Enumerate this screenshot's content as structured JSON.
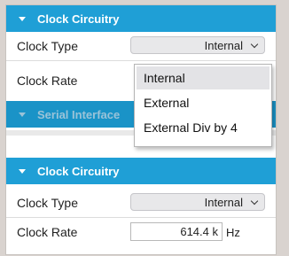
{
  "top_section": {
    "header": "Clock Circuitry",
    "clock_type_label": "Clock Type",
    "clock_type_value": "Internal",
    "clock_rate_label": "Clock Rate"
  },
  "serial_section": {
    "header": "Serial Interface"
  },
  "dropdown": {
    "options": [
      "Internal",
      "External",
      "External Div by 4"
    ],
    "selected": "Internal"
  },
  "bottom_section": {
    "header": "Clock Circuitry",
    "clock_type_label": "Clock Type",
    "clock_type_value": "Internal",
    "clock_rate_label": "Clock Rate",
    "clock_rate_value": "614.4 k",
    "clock_rate_unit": "Hz"
  },
  "colors": {
    "header_bg": "#1f9fd6",
    "header_text": "#ffffff"
  }
}
